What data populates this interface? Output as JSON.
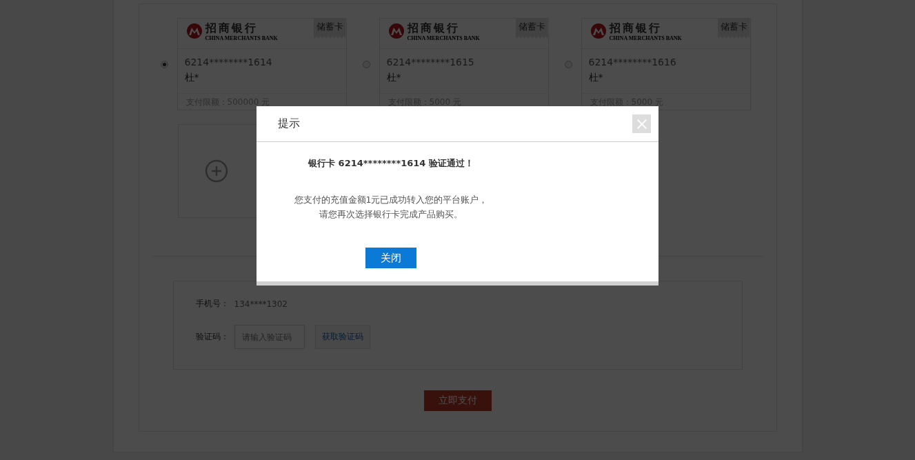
{
  "cards": [
    {
      "bank_name": "招商银行",
      "bank_name_en": "CHINA MERCHANTS BANK",
      "card_type": "储蓄卡",
      "number": "6214********1614",
      "holder": "杜*",
      "limit": "支付限额：500000 元",
      "selected": true
    },
    {
      "bank_name": "招商银行",
      "bank_name_en": "CHINA MERCHANTS BANK",
      "card_type": "储蓄卡",
      "number": "6214********1615",
      "holder": "杜*",
      "limit": "支付限额：5000 元",
      "selected": false
    },
    {
      "bank_name": "招商银行",
      "bank_name_en": "CHINA MERCHANTS BANK",
      "card_type": "储蓄卡",
      "number": "6214********1616",
      "holder": "杜*",
      "limit": "支付限额：5000 元",
      "selected": false
    }
  ],
  "verify": {
    "phone_label": "手机号：",
    "phone": "134****1302",
    "code_label": "验证码：",
    "code_placeholder": "请输入验证码",
    "get_code_button": "获取验证码"
  },
  "pay_button": "立即支付",
  "dialog": {
    "title": "提示",
    "headline": "银行卡 6214********1614 验证通过！",
    "message_lines": [
      "您支付的充值金额1元已成功转入您的平台账户，",
      "请您再次选择银行卡完成产品购买。"
    ],
    "close_button": "关闭"
  }
}
